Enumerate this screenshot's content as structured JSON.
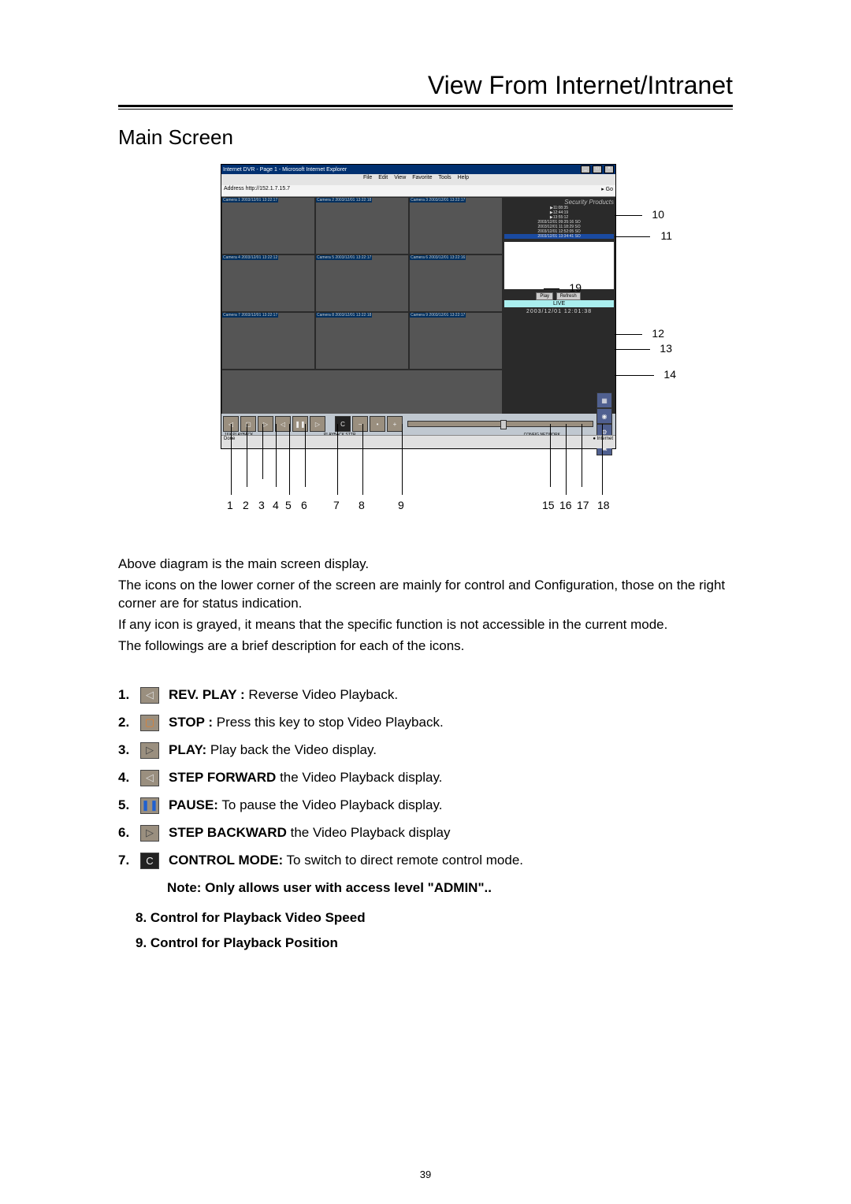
{
  "header": {
    "title": "View From Internet/Intranet"
  },
  "main_heading": "Main Screen",
  "figure": {
    "window_title": "Internet DVR - Page 1 - Microsoft Internet Explorer",
    "menubar": [
      "File",
      "Edit",
      "View",
      "Favorite",
      "Tools",
      "Help"
    ],
    "address_label": "Address",
    "address_value": "http://152.1.7.15.7",
    "go_label": "Go",
    "brand": "Security Products",
    "segs_header": [
      "▶11:08:35",
      "▶12:44:19",
      "▶13:55:12"
    ],
    "segments": [
      "2003/12/01 09:35:16  SO",
      "2003/12/01 11:18:29  SO",
      "2003/12/01 12:52:05  SO",
      "2003/12/01 13:34:41  SO"
    ],
    "play_btn": "Play",
    "refresh_btn": "Refresh",
    "live_label": "LIVE",
    "datetime": "2003/12/01  12:01:38",
    "camera_labels": [
      "Camera 1 2003/12/01 13:22:17",
      "Camera 2 2003/12/01 13:22:18",
      "Camera 3 2003/12/01 13:22:17",
      "Camera 4 2003/12/01 13:22:12",
      "Camera 5 2003/12/01 13:22:17",
      "Camera 6 2003/12/01 13:22:16",
      "Camera 7 2003/12/01 13:22:17",
      "Camera 8 2003/12/01 13:22:18",
      "Camera 9 2003/12/01 13:22:17"
    ],
    "ie_status_left": "Done",
    "ie_status_right": "Internet",
    "tb_status_left": "16X  PLAYBACK",
    "tb_status_right_a": "PLAYBACK STTR",
    "tb_status_right_b": "CONFIG  NETWORK",
    "bottom_numbers_left": [
      "1",
      "2",
      "3",
      "4",
      "5",
      "6",
      "7",
      "8",
      "9"
    ],
    "bottom_numbers_right": [
      "15",
      "16",
      "17",
      "18"
    ],
    "right_callouts": [
      "10",
      "11",
      "19",
      "12",
      "13",
      "14"
    ],
    "toolbar_glyphs": [
      "◁",
      "▢",
      "▷",
      "◁",
      "❚❚",
      "▷",
      "C",
      "−",
      "•",
      "+"
    ],
    "right_icon_glyphs": [
      "▦",
      "◉",
      "⚙",
      "▣"
    ]
  },
  "body": {
    "p1": "Above diagram is the main screen display.",
    "p2": "The icons on the lower corner of the screen are mainly for control and Configuration, those on the right corner are for status indication.",
    "p3": "If any icon is grayed, it means that the specific function is not accessible in the current mode.",
    "p4": "The followings are a brief description for each of the icons."
  },
  "items": [
    {
      "n": "1.",
      "icon": "◁",
      "bg": "#9a8f7f",
      "fg": "#dcdcdc",
      "bold": "REV. PLAY :",
      "text": "  Reverse Video Playback."
    },
    {
      "n": "2.",
      "icon": "▢",
      "bg": "#9a8f7f",
      "fg": "#e08030",
      "bold": "STOP :",
      "text": " Press this key to stop Video Playback."
    },
    {
      "n": "3.",
      "icon": "▷",
      "bg": "#9a8f7f",
      "fg": "#444",
      "bold": "PLAY:",
      "text": " Play back the Video display."
    },
    {
      "n": "4.",
      "icon": "◁",
      "bg": "#9a8f7f",
      "fg": "#dcdcdc",
      "bold": "STEP FORWARD",
      "text": " the Video Playback display."
    },
    {
      "n": "5.",
      "icon": "❚❚",
      "bg": "#9a8f7f",
      "fg": "#2060d0",
      "bold": "PAUSE:",
      "text": " To pause the Video Playback display."
    },
    {
      "n": "6.",
      "icon": "▷",
      "bg": "#9a8f7f",
      "fg": "#444",
      "bold": "STEP BACKWARD",
      "text": " the Video Playback display"
    },
    {
      "n": "7.",
      "icon": "C",
      "bg": "#222",
      "fg": "#eee",
      "bold": "CONTROL MODE:",
      "text": " To switch to direct remote control mode."
    }
  ],
  "note": "Note: Only allows user with access level \"ADMIN\"..",
  "item8": "8. Control for Playback Video Speed",
  "item9": "9. Control for Playback Position",
  "page_number": "39"
}
